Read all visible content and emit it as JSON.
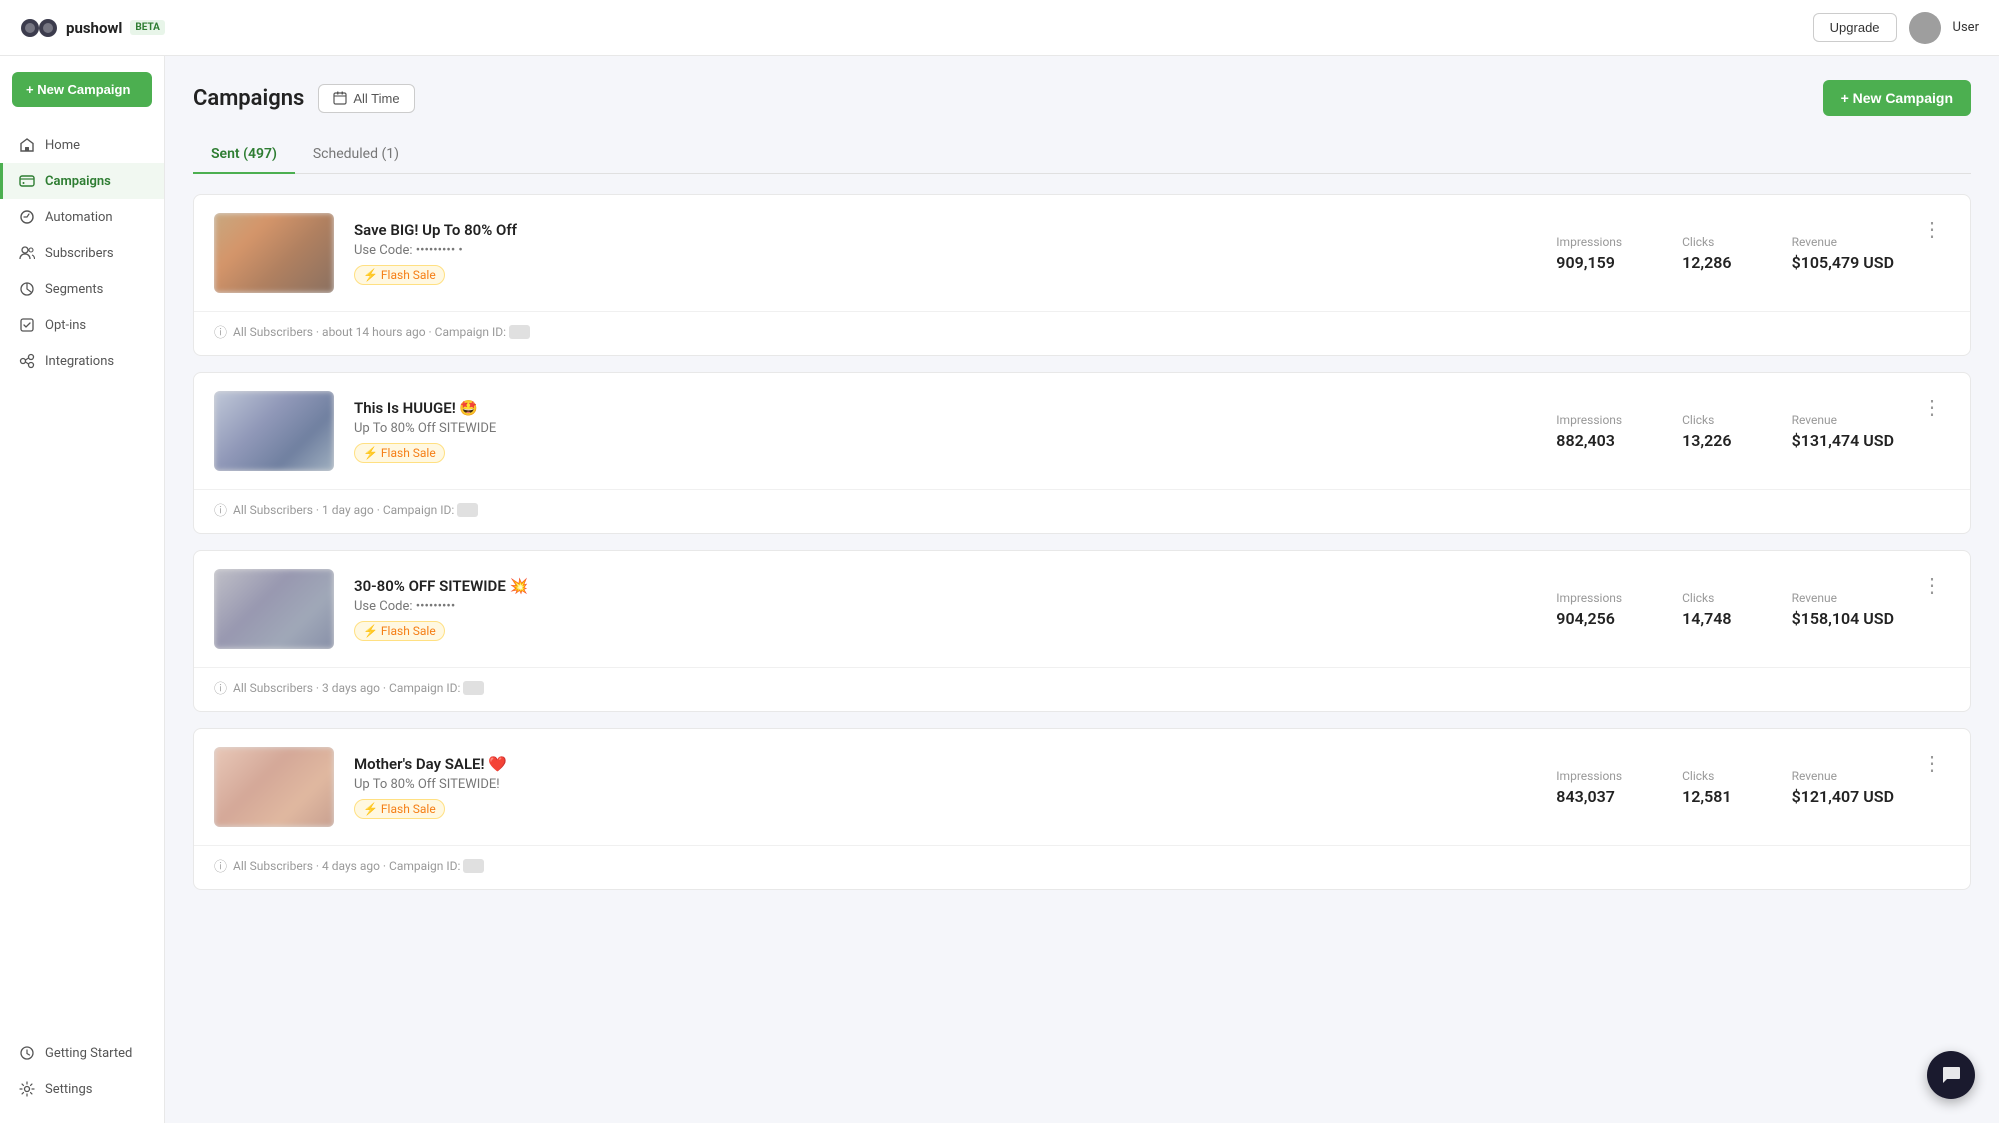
{
  "app": {
    "logo_text": "pushowl",
    "beta_label": "BETA"
  },
  "topbar": {
    "upgrade_label": "Upgrade",
    "user_name": "User"
  },
  "sidebar": {
    "new_campaign_label": "+ New Campaign",
    "nav_items": [
      {
        "id": "home",
        "label": "Home",
        "icon": "home-icon",
        "active": false
      },
      {
        "id": "campaigns",
        "label": "Campaigns",
        "icon": "campaigns-icon",
        "active": true
      },
      {
        "id": "automation",
        "label": "Automation",
        "icon": "automation-icon",
        "active": false
      },
      {
        "id": "subscribers",
        "label": "Subscribers",
        "icon": "subscribers-icon",
        "active": false
      },
      {
        "id": "segments",
        "label": "Segments",
        "icon": "segments-icon",
        "active": false
      },
      {
        "id": "optins",
        "label": "Opt-ins",
        "icon": "optins-icon",
        "active": false
      },
      {
        "id": "integrations",
        "label": "Integrations",
        "icon": "integrations-icon",
        "active": false
      }
    ],
    "bottom_nav": [
      {
        "id": "getting-started",
        "label": "Getting Started",
        "icon": "getting-started-icon"
      },
      {
        "id": "settings",
        "label": "Settings",
        "icon": "settings-icon"
      }
    ]
  },
  "page": {
    "title": "Campaigns",
    "time_filter": "All Time",
    "new_campaign_label": "+ New Campaign",
    "tabs": [
      {
        "id": "sent",
        "label": "Sent (497)",
        "active": true
      },
      {
        "id": "scheduled",
        "label": "Scheduled (1)",
        "active": false
      }
    ]
  },
  "campaigns": [
    {
      "id": 1,
      "title": "Save BIG! Up To 80% Off",
      "subtitle": "Use Code: ••••••••• •",
      "tag": "⚡ Flash Sale",
      "thumb_class": "thumb-blur",
      "impressions": "909,159",
      "clicks": "12,286",
      "revenue": "$105,479 USD",
      "footer_text": "All Subscribers · about 14 hours ago · Campaign ID:",
      "campaign_id": "•••••••"
    },
    {
      "id": 2,
      "title": "This Is HUUGE! 🤩",
      "subtitle": "Up To 80% Off SITEWIDE",
      "tag": "⚡ Flash Sale",
      "thumb_class": "thumb-blur-2",
      "impressions": "882,403",
      "clicks": "13,226",
      "revenue": "$131,474 USD",
      "footer_text": "All Subscribers · 1 day ago · Campaign ID:",
      "campaign_id": "•••••••"
    },
    {
      "id": 3,
      "title": "30-80% OFF SITEWIDE 💥",
      "subtitle": "Use Code: •••••••••",
      "tag": "⚡ Flash Sale",
      "thumb_class": "thumb-blur-3",
      "impressions": "904,256",
      "clicks": "14,748",
      "revenue": "$158,104 USD",
      "footer_text": "All Subscribers · 3 days ago · Campaign ID:",
      "campaign_id": "•••••••"
    },
    {
      "id": 4,
      "title": "Mother's Day SALE! ❤️",
      "subtitle": "Up To 80% Off SITEWIDE!",
      "tag": "⚡ Flash Sale",
      "thumb_class": "thumb-blur-4",
      "impressions": "843,037",
      "clicks": "12,581",
      "revenue": "$121,407 USD",
      "footer_text": "All Subscribers · 4 days ago · Campaign ID:",
      "campaign_id": "•••••••"
    }
  ],
  "labels": {
    "impressions": "Impressions",
    "clicks": "Clicks",
    "revenue": "Revenue"
  }
}
